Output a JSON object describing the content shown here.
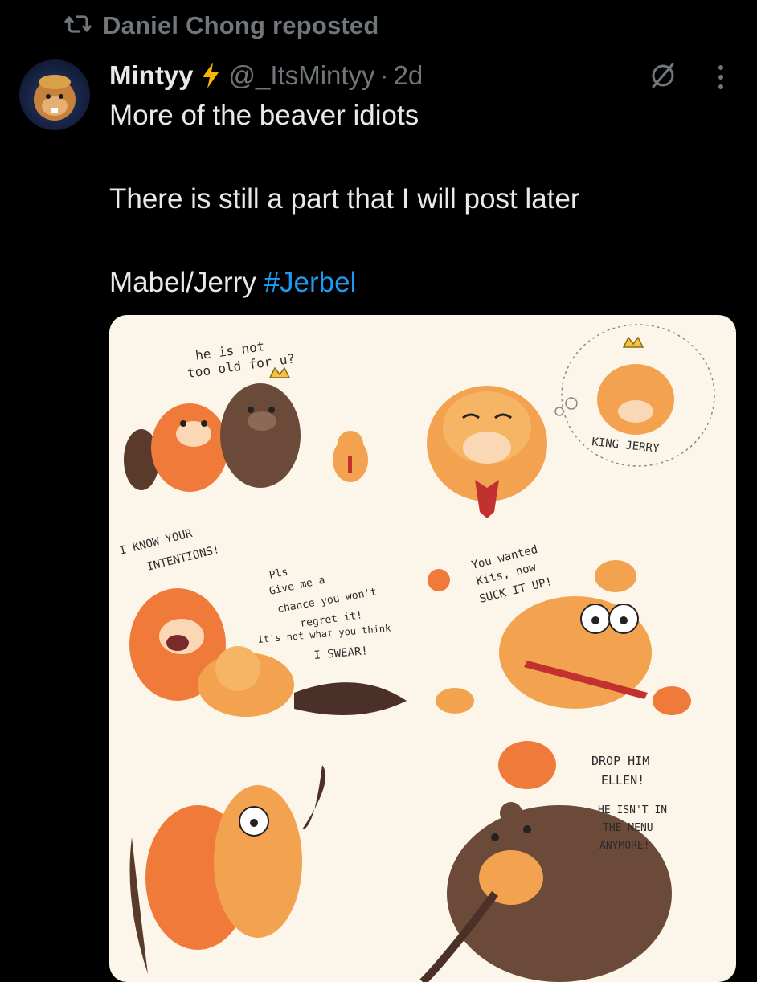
{
  "repost": {
    "icon": "repost-icon",
    "text": "Daniel Chong reposted"
  },
  "author": {
    "display_name": "Mintyy",
    "badge_icon": "lightning-bolt-icon",
    "handle": "@_ItsMintyy",
    "separator": "·",
    "time": "2d"
  },
  "actions": {
    "grok_icon": "grok-icon",
    "more_icon": "more-vertical-icon"
  },
  "tweet": {
    "line1": "More of the beaver idiots",
    "line2": "There is still a part that I will post later",
    "line3_text": "Mabel/Jerry ",
    "hashtag": "#Jerbel"
  },
  "media": {
    "captions": {
      "c1a": "he is not",
      "c1b": "too old for u?",
      "king": "KING JERRY",
      "know1": "I KNOW YOUR",
      "know2": "INTENTIONS!",
      "pls1": "Pls",
      "pls2": "Give me a",
      "pls3": "chance you won't",
      "pls4": "regret it!",
      "pls5": "It's not what you think",
      "pls6": "I SWEAR!",
      "kits1": "You wanted",
      "kits2": "Kits, now",
      "kits3": "SUCK IT UP!",
      "drop1": "DROP HIM",
      "drop2": "ELLEN!",
      "menu1": "HE ISN'T IN",
      "menu2": "THE MENU",
      "menu3": "ANYMORE!"
    }
  },
  "colors": {
    "background": "#000000",
    "text_primary": "#e7e9ea",
    "text_secondary": "#71767b",
    "link": "#1d9bf0",
    "bolt": "#f9b600",
    "paper": "#fbf6e9"
  }
}
